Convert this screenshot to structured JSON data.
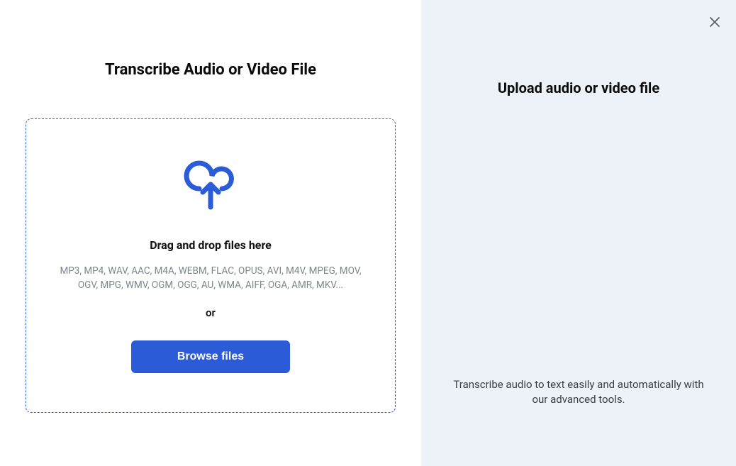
{
  "left": {
    "title": "Transcribe Audio or Video File",
    "dropzone": {
      "drag_text": "Drag and drop files here",
      "formats": "MP3, MP4, WAV, AAC, M4A, WEBM, FLAC, OPUS, AVI, M4V, MPEG, MOV, OGV, MPG, WMV, OGM, OGG, AU, WMA, AIFF, OGA, AMR, MKV...",
      "or": "or",
      "browse_label": "Browse files"
    }
  },
  "right": {
    "title": "Upload audio or video file",
    "description": "Transcribe audio to text easily and automatically with our advanced tools."
  },
  "colors": {
    "accent": "#2b5bd6",
    "right_bg": "#edf2f9"
  }
}
